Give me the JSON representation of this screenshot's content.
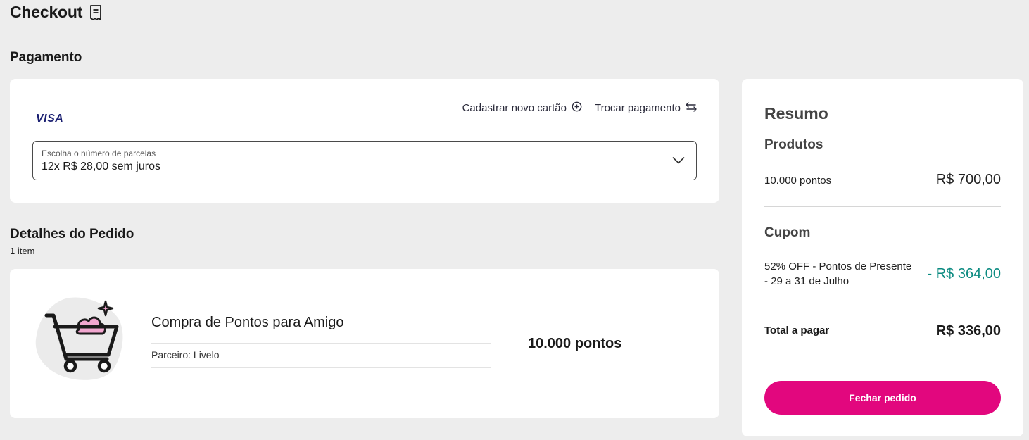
{
  "page": {
    "title": "Checkout",
    "title_icon": "receipt-icon"
  },
  "payment": {
    "heading": "Pagamento",
    "card_brand": "VISA",
    "add_card_label": "Cadastrar novo cartão",
    "add_card_icon": "plus-circle-icon",
    "change_payment_label": "Trocar pagamento",
    "change_payment_icon": "swap-arrows-icon",
    "installments": {
      "label": "Escolha o número de parcelas",
      "selected": "12x R$ 28,00 sem juros"
    }
  },
  "order": {
    "heading": "Detalhes do Pedido",
    "item_count": "1 item",
    "items": [
      {
        "name": "Compra de Pontos para Amigo",
        "partner": "Parceiro: Livelo",
        "points": "10.000 pontos",
        "icon": "shopping-cart-icon"
      }
    ]
  },
  "summary": {
    "title": "Resumo",
    "products_heading": "Produtos",
    "products_label": "10.000 pontos",
    "products_value": "R$ 700,00",
    "coupon_heading": "Cupom",
    "coupon_label": "52% OFF - Pontos de Presente - 29 a 31 de Julho",
    "coupon_value": "- R$ 364,00",
    "total_label": "Total a pagar",
    "total_value": "R$ 336,00",
    "button_label": "Fechar pedido"
  },
  "colors": {
    "accent": "#e2077e",
    "discount": "#0a8a80",
    "background": "#ededed",
    "visa": "#1a1f71"
  }
}
